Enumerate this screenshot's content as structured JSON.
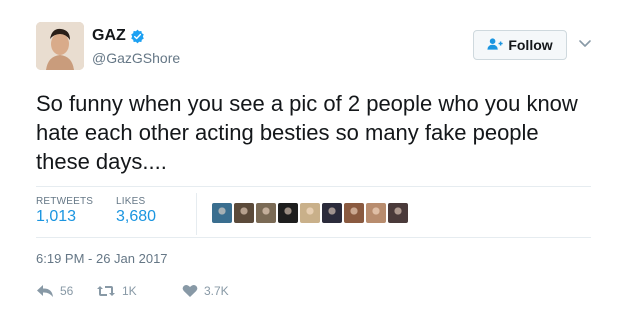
{
  "user": {
    "name": "GAZ",
    "handle": "@GazGShore"
  },
  "follow": {
    "label": "Follow"
  },
  "tweet": {
    "text": "So funny when you see a pic of 2 people who you know hate each other acting besties so many fake people these days...."
  },
  "stats": {
    "retweets_label": "RETWEETS",
    "retweets_value": "1,013",
    "likes_label": "LIKES",
    "likes_value": "3,680"
  },
  "likers": [
    {
      "icon": "liker-avatar",
      "color": "#3a6e8f"
    },
    {
      "icon": "liker-avatar",
      "color": "#5b4a3a"
    },
    {
      "icon": "liker-avatar",
      "color": "#7a6a55"
    },
    {
      "icon": "liker-avatar",
      "color": "#1e1e1e"
    },
    {
      "icon": "liker-avatar",
      "color": "#c9b08a"
    },
    {
      "icon": "liker-avatar",
      "color": "#2b2b3b"
    },
    {
      "icon": "liker-avatar",
      "color": "#8a5a40"
    },
    {
      "icon": "liker-avatar",
      "color": "#b88c6e"
    },
    {
      "icon": "liker-avatar",
      "color": "#4a3a3a"
    }
  ],
  "timestamp": "6:19 PM - 26 Jan 2017",
  "actions": {
    "reply_count": "56",
    "retweet_count": "1K",
    "like_count": "3.7K"
  },
  "colors": {
    "accent": "#1b95e0",
    "verified": "#1da1f2",
    "muted": "#657786"
  }
}
